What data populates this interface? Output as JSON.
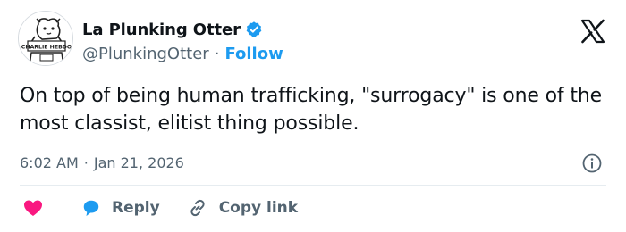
{
  "colors": {
    "accent": "#1d9bf0",
    "text_primary": "#0f1419",
    "text_secondary": "#536471",
    "like": "#f91880",
    "divider": "#e6ecf0"
  },
  "header": {
    "display_name": "La Plunking Otter",
    "verified_icon": "verified-badge-icon",
    "handle": "@PlunkingOtter",
    "separator": "·",
    "follow_label": "Follow",
    "platform_icon": "x-logo-icon"
  },
  "avatar": {
    "sign_text": "CHARLIE HEBDO"
  },
  "tweet": {
    "text": "On top of being human trafficking, \"surrogacy\" is one of the most classist, elitist thing possible."
  },
  "meta": {
    "time": "6:02 AM",
    "separator": "·",
    "date": "Jan 21, 2026",
    "info_icon": "info-icon"
  },
  "actions": {
    "like_icon": "heart-icon",
    "reply_icon": "speech-bubble-icon",
    "reply_label": "Reply",
    "copy_icon": "link-icon",
    "copy_label": "Copy link"
  }
}
